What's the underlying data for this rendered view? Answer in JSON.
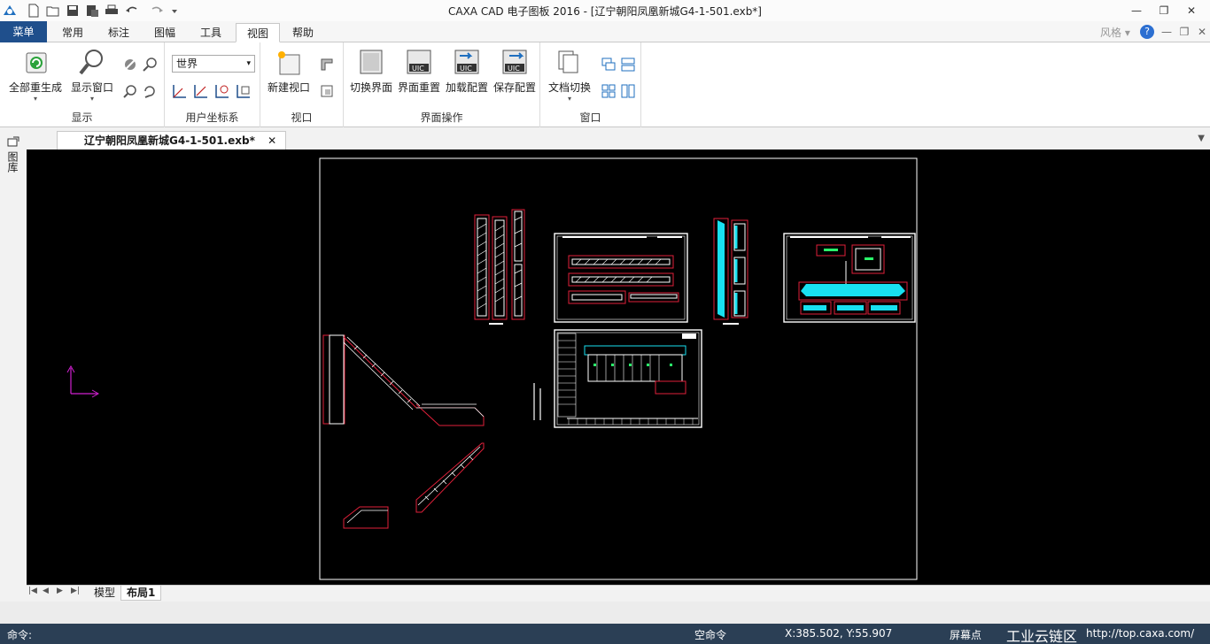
{
  "app": {
    "title": "CAXA CAD 电子图板 2016 - [辽宁朝阳凤凰新城G4-1-501.exb*]",
    "style_label": "风格"
  },
  "tabs": {
    "menu": "菜单",
    "items": [
      {
        "label": "常用"
      },
      {
        "label": "标注"
      },
      {
        "label": "图幅"
      },
      {
        "label": "工具"
      },
      {
        "label": "视图"
      },
      {
        "label": "帮助"
      }
    ]
  },
  "ribbon": {
    "display": {
      "name": "显示",
      "regen_all": "全部重生成",
      "display_window": "显示窗口"
    },
    "ucs": {
      "name": "用户坐标系",
      "combo_value": "世界"
    },
    "viewport": {
      "name": "视口",
      "new_viewport": "新建视口"
    },
    "ui_ops": {
      "name": "界面操作",
      "switch_ui": "切换界面",
      "reset_ui": "界面重置",
      "load_config": "加载配置",
      "save_config": "保存配置"
    },
    "window": {
      "name": "窗口",
      "doc_switch": "文档切换"
    }
  },
  "document": {
    "tab_label": "辽宁朝阳凤凰新城G4-1-501.exb*",
    "side_label": "图库"
  },
  "layout_tabs": {
    "model": "模型",
    "layout1": "布局1"
  },
  "status": {
    "command_prompt": "命令:",
    "empty_command": "空命令",
    "coords": "X:385.502, Y:55.907",
    "snap_mode": "屏幕点",
    "watermark": "工业云链区",
    "url": "http://top.caxa.com/"
  },
  "colors": {
    "accent": "#1f4f8c",
    "drawing_white": "#ffffff",
    "drawing_red": "#e0203a",
    "drawing_cyan": "#18e0f0",
    "drawing_magenta": "#c020c0"
  }
}
